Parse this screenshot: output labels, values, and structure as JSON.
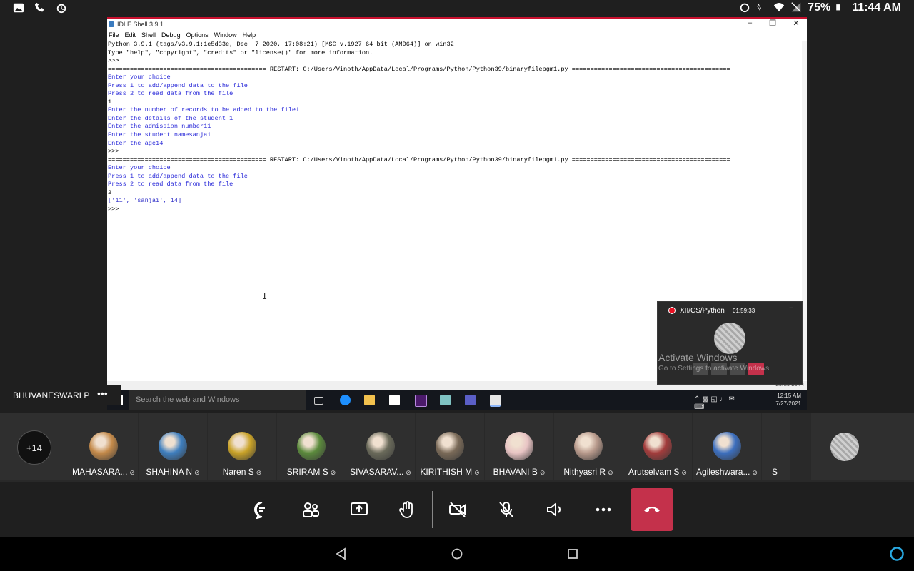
{
  "status_bar": {
    "battery": "75%",
    "time": "11:44 AM"
  },
  "idle": {
    "window_title": "IDLE Shell 3.9.1",
    "menu": [
      "File",
      "Edit",
      "Shell",
      "Debug",
      "Options",
      "Window",
      "Help"
    ],
    "lines": [
      {
        "t": "Python 3.9.1 (tags/v3.9.1:1e5d33e, Dec  7 2020, 17:08:21) [MSC v.1927 64 bit (AMD64)] on win32",
        "c": "blk"
      },
      {
        "t": "Type \"help\", \"copyright\", \"credits\" or \"license()\" for more information.",
        "c": "blk"
      },
      {
        "t": ">>> ",
        "c": "blk"
      },
      {
        "t": "=========================================== RESTART: C:/Users/Vinoth/AppData/Local/Programs/Python/Python39/binaryfilepgm1.py ===========================================",
        "c": "blk"
      },
      {
        "t": "Enter your choice",
        "c": "blue"
      },
      {
        "t": "Press 1 to add/append data to the file",
        "c": "blue"
      },
      {
        "t": "Press 2 to read data from the file",
        "c": "blue"
      },
      {
        "t": "1",
        "c": "blk"
      },
      {
        "t": "Enter the number of records to be added to the file1",
        "c": "blue"
      },
      {
        "t": "Enter the details of the student 1",
        "c": "blue"
      },
      {
        "t": "Enter the admission number11",
        "c": "blue"
      },
      {
        "t": "Enter the student namesanjai",
        "c": "blue"
      },
      {
        "t": "Enter the age14",
        "c": "blue"
      },
      {
        "t": ">>> ",
        "c": "blk"
      },
      {
        "t": "=========================================== RESTART: C:/Users/Vinoth/AppData/Local/Programs/Python/Python39/binaryfilepgm1.py ===========================================",
        "c": "blk"
      },
      {
        "t": "Enter your choice",
        "c": "blue"
      },
      {
        "t": "Press 1 to add/append data to the file",
        "c": "blue"
      },
      {
        "t": "Press 2 to read data from the file",
        "c": "blue"
      },
      {
        "t": "2",
        "c": "blk"
      },
      {
        "t": "['11', 'sanjai', 14]",
        "c": "outb"
      },
      {
        "t": ">>> ",
        "c": "blk"
      }
    ],
    "status_line": "Ln: 21   Col: 4"
  },
  "taskbar": {
    "search_placeholder": "Search the web and Windows",
    "time": "12:15 AM",
    "date": "7/27/2021"
  },
  "mini_panel": {
    "title": "XII/CS/Python",
    "elapsed": "01:59:33"
  },
  "watermark": {
    "line1": "Activate Windows",
    "line2": "Go to Settings to activate Windows."
  },
  "presenter": {
    "name": "BHUVANESWARI P",
    "more": "•••"
  },
  "overflow_count": "+14",
  "participants": [
    {
      "name": "MAHASARA...",
      "color": "#c48a4a"
    },
    {
      "name": "SHAHINA N",
      "color": "#3f7fbf"
    },
    {
      "name": "Naren S",
      "color": "#c9a227"
    },
    {
      "name": "SRIRAM S",
      "color": "#5b8a3c"
    },
    {
      "name": "SIVASARAV...",
      "color": "#6a6a5a"
    },
    {
      "name": "KIRITHISH M",
      "color": "#7a6a58"
    },
    {
      "name": "BHAVANI B",
      "color": "#e8c4c4"
    },
    {
      "name": "Nithyasri R",
      "color": "#b89a8c"
    },
    {
      "name": "Arutselvam S",
      "color": "#a33c3c"
    },
    {
      "name": "Agileshwara...",
      "color": "#3c6fbf"
    },
    {
      "name": "S",
      "color": ""
    }
  ]
}
